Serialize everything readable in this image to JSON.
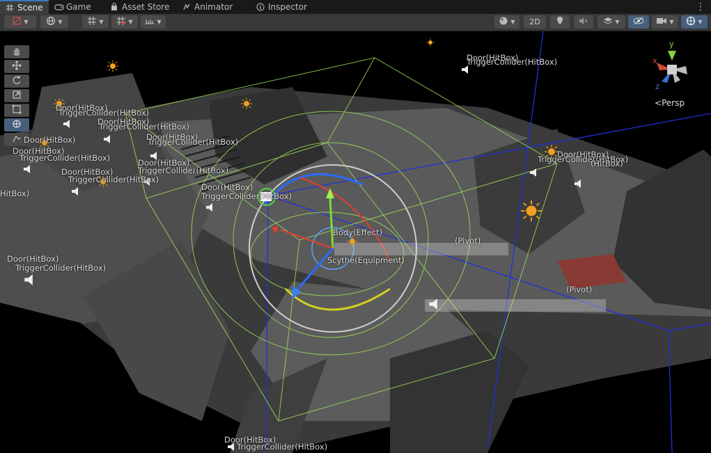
{
  "tabs": [
    {
      "label": "Scene",
      "icon": "hash-icon",
      "active": true
    },
    {
      "label": "Game",
      "icon": "gamepad-icon",
      "active": false
    },
    {
      "label": "Asset Store",
      "icon": "shopping-bag-icon",
      "active": false
    },
    {
      "label": "Animator",
      "icon": "animator-icon",
      "active": false
    },
    {
      "label": "Inspector",
      "icon": "info-icon",
      "active": false
    }
  ],
  "toolbar": {
    "mode_2d": "2D"
  },
  "tools": [
    "hand-tool-icon",
    "move-tool-icon",
    "rotate-tool-icon",
    "scale-tool-icon",
    "rect-tool-icon",
    "transform-tool-icon",
    "custom-tool-icon"
  ],
  "gizmo": {
    "axis_y": "y",
    "axis_x": "x",
    "axis_z": "z",
    "projection": "Persp"
  },
  "labels": [
    {
      "text": "Door(HitBox)"
    },
    {
      "text": "TriggerCollider(HitBox)"
    },
    {
      "text": "Door(HitBox)"
    },
    {
      "text": "TriggerCollider(HitBox)"
    },
    {
      "text": "Door(HitBox)"
    },
    {
      "text": "TriggerCollider(HitBox)"
    },
    {
      "text": "Door(HitBox)"
    },
    {
      "text": "Door(HitBox)"
    },
    {
      "text": "TriggerCollider(HitBox)"
    },
    {
      "text": "Door(HitBox)"
    },
    {
      "text": "TriggerCollider(HitBox)"
    },
    {
      "text": "Door(HitBox)"
    },
    {
      "text": "TriggerCollider(HitBox)"
    },
    {
      "text": "Door(HitBox)"
    },
    {
      "text": "TriggerCollider(HitBox)"
    },
    {
      "text": "Door(HitBox)"
    },
    {
      "text": "TriggerCollider(HitBox)"
    },
    {
      "text": "HitBox)"
    },
    {
      "text": "Door(HitBox)"
    },
    {
      "text": "TriggerCollider(HitBox)"
    },
    {
      "text": "(HitBox)"
    },
    {
      "text": "Door(HitBox)"
    },
    {
      "text": "TriggerCollider(HitBox)"
    },
    {
      "text": "Door(HitBox)"
    },
    {
      "text": "TriggerCollider(HitBox)"
    },
    {
      "text": "Body(Effect)"
    },
    {
      "text": "Scythe(Equipment)"
    },
    {
      "text": "(Pivot)"
    },
    {
      "text": "(Pivot)"
    }
  ],
  "colors": {
    "tab_bg": "#191919",
    "toolbar_bg": "#383838",
    "accent": "#3a79bb",
    "bounds_green": "#9be05a",
    "bounds_blue": "#2030d8",
    "geometry": "#555555"
  }
}
